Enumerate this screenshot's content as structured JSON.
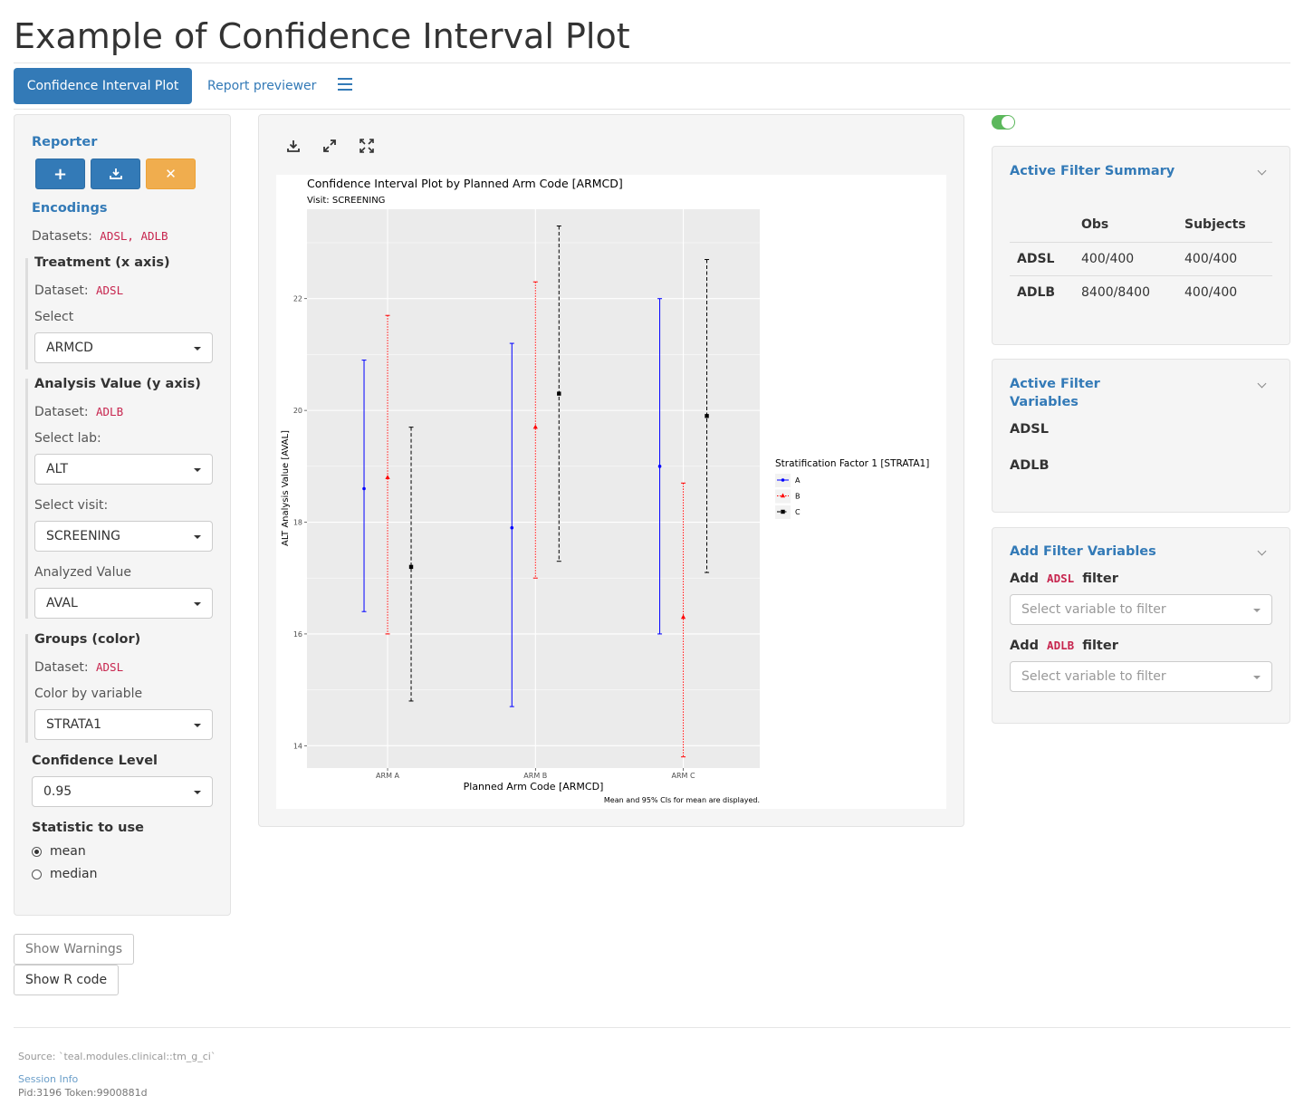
{
  "page": {
    "title": "Example of Confidence Interval Plot"
  },
  "tabs": [
    {
      "label": "Confidence Interval Plot",
      "active": true
    },
    {
      "label": "Report previewer",
      "active": false
    }
  ],
  "encodings_panel": {
    "reporter_label": "Reporter",
    "encodings_label": "Encodings",
    "datasets_label": "Datasets:",
    "datasets_value": "ADSL, ADLB",
    "treatment": {
      "title": "Treatment (x axis)",
      "dataset_label": "Dataset:",
      "dataset_value": "ADSL",
      "select_label": "Select",
      "select_value": "ARMCD"
    },
    "analysis": {
      "title": "Analysis Value (y axis)",
      "dataset_label": "Dataset:",
      "dataset_value": "ADLB",
      "lab_label": "Select lab:",
      "lab_value": "ALT",
      "visit_label": "Select visit:",
      "visit_value": "SCREENING",
      "analyzed_label": "Analyzed Value",
      "analyzed_value": "AVAL"
    },
    "groups": {
      "title": "Groups (color)",
      "dataset_label": "Dataset:",
      "dataset_value": "ADSL",
      "color_label": "Color by variable",
      "color_value": "STRATA1"
    },
    "confidence": {
      "label": "Confidence Level",
      "value": "0.95"
    },
    "statistic": {
      "label": "Statistic to use",
      "options": [
        "mean",
        "median"
      ],
      "selected": "mean"
    }
  },
  "buttons": {
    "show_warnings": "Show Warnings",
    "show_r_code": "Show R code"
  },
  "footer": {
    "source": "Source: `teal.modules.clinical::tm_g_ci`",
    "session_info": "Session Info",
    "pid": "Pid:3196 Token:9900881d"
  },
  "filter_panel": {
    "summary_title": "Active Filter Summary",
    "table_headers": [
      "",
      "Obs",
      "Subjects"
    ],
    "table_rows": [
      [
        "ADSL",
        "400/400",
        "400/400"
      ],
      [
        "ADLB",
        "8400/8400",
        "400/400"
      ]
    ],
    "active_vars_title_1": "Active Filter",
    "active_vars_title_2": "Variables",
    "active_datasets": [
      "ADSL",
      "ADLB"
    ],
    "add_title": "Add Filter Variables",
    "add_word": "Add",
    "filter_word": "filter",
    "add_adsl_dataset": "ADSL",
    "add_adlb_dataset": "ADLB",
    "select_placeholder": "Select variable to filter"
  },
  "colors": {
    "primary": "#337ab7",
    "warning": "#f0ad4e",
    "toggle": "#5cb85c",
    "series_A": "#0000ff",
    "series_B": "#ff0000",
    "series_C": "#000000"
  },
  "chart_data": {
    "type": "scatter",
    "title": "Confidence Interval Plot by Planned Arm Code [ARMCD]",
    "subtitle": "Visit: SCREENING",
    "xlabel": "Planned Arm Code [ARMCD]",
    "ylabel": "ALT Analysis Value [AVAL]",
    "caption": "Mean and 95% CIs for mean are displayed.",
    "legend_title": "Stratification Factor 1 [STRATA1]",
    "legend_position": "right",
    "categories": [
      "ARM A",
      "ARM B",
      "ARM C"
    ],
    "ylim": [
      13.6,
      23.6
    ],
    "yticks": [
      14,
      16,
      18,
      20,
      22
    ],
    "grid": true,
    "series": [
      {
        "name": "A",
        "color": "#0000ff",
        "linestyle": "solid",
        "marker": "circle",
        "mean": [
          18.6,
          17.9,
          19.0
        ],
        "lower": [
          16.4,
          14.7,
          16.0
        ],
        "upper": [
          20.9,
          21.2,
          22.0
        ]
      },
      {
        "name": "B",
        "color": "#ff0000",
        "linestyle": "dotted",
        "marker": "triangle",
        "mean": [
          18.8,
          19.7,
          16.3
        ],
        "lower": [
          16.0,
          17.0,
          13.8
        ],
        "upper": [
          21.7,
          22.3,
          18.7
        ]
      },
      {
        "name": "C",
        "color": "#000000",
        "linestyle": "dashed",
        "marker": "square",
        "mean": [
          17.2,
          20.3,
          19.9
        ],
        "lower": [
          14.8,
          17.3,
          17.1
        ],
        "upper": [
          19.7,
          23.3,
          22.7
        ]
      }
    ]
  }
}
